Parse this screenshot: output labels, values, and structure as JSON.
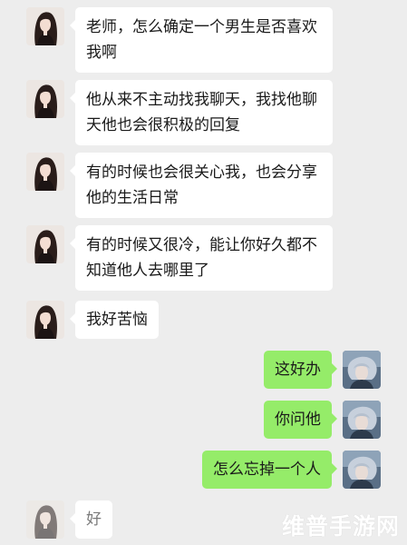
{
  "messages": [
    {
      "side": "left",
      "text": "老师，怎么确定一个男生是否喜欢\n我啊"
    },
    {
      "side": "left",
      "text": "他从来不主动找我聊天，我找他聊\n天他也会很积极的回复"
    },
    {
      "side": "left",
      "text": "有的时候也会很关心我，也会分享\n他的生活日常"
    },
    {
      "side": "left",
      "text": "有的时候又很冷，能让你好久都不\n知道他人去哪里了"
    },
    {
      "side": "left",
      "text": "我好苦恼"
    },
    {
      "side": "right",
      "text": "这好办"
    },
    {
      "side": "right",
      "text": "你问他"
    },
    {
      "side": "right",
      "text": "怎么忘掉一个人"
    },
    {
      "side": "left",
      "text": "好"
    }
  ],
  "watermark": "维普手游网",
  "colors": {
    "background": "#ededed",
    "incoming_bubble": "#ffffff",
    "outgoing_bubble": "#95ec69"
  },
  "icons": {
    "incoming_avatar": "girl-avatar-icon",
    "outgoing_avatar": "boy-avatar-icon"
  }
}
